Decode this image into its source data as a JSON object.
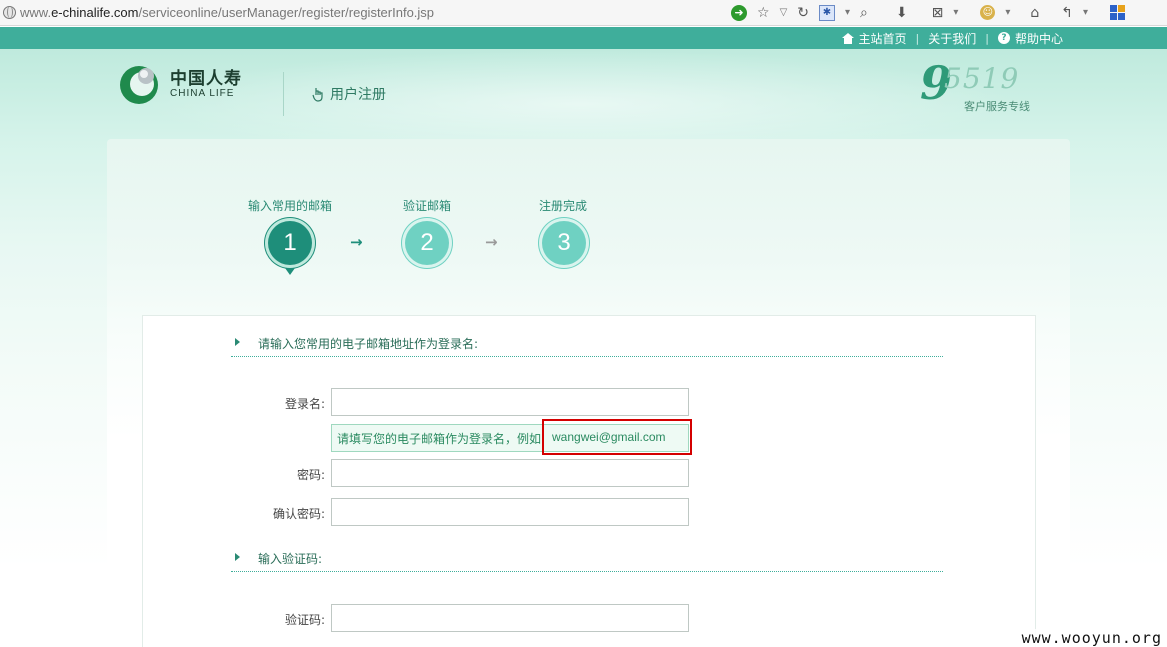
{
  "browser": {
    "url_prefix": "www.",
    "url_domain": "e-chinalife.com",
    "url_path": "/serviceonline/userManager/register/registerInfo.jsp",
    "go_icon": "green-arrow-icon",
    "toolbar_icons": [
      "go-icon",
      "star-icon",
      "dropdown-icon",
      "refresh-icon",
      "search-engine-icon",
      "download-icon",
      "screenshot-icon",
      "addon-icon",
      "home-icon",
      "back-share-icon",
      "windows-icon"
    ]
  },
  "topnav": {
    "home": "主站首页",
    "sep": "|",
    "about": "关于我们",
    "help": "帮助中心",
    "help_glyph": "?"
  },
  "logo": {
    "cn": "中国人寿",
    "en": "CHINA LIFE"
  },
  "page_tag": "用户注册",
  "hotline": {
    "number_head": "9",
    "number_tail": "5519",
    "label": "客户服务专线"
  },
  "steps": [
    {
      "label": "输入常用的邮箱",
      "num": "1",
      "state": "active"
    },
    {
      "label": "验证邮箱",
      "num": "2",
      "state": "inactive"
    },
    {
      "label": "注册完成",
      "num": "3",
      "state": "inactive"
    }
  ],
  "arrow_glyph": "→",
  "colors": {
    "accent": "#3fae9b",
    "active_step": "#1e8e7a",
    "inactive_step": "#6fd1c2",
    "highlight": "#d40000"
  },
  "form": {
    "section1_title": "请输入您常用的电子邮箱地址作为登录名:",
    "login_label": "登录名:",
    "login_value": "",
    "hint": "请填写您的电子邮箱作为登录名，例如",
    "hint_example": "wangwei@gmail.com",
    "password_label": "密码:",
    "password_value": "",
    "confirm_label": "确认密码:",
    "confirm_value": "",
    "section2_title": "输入验证码:",
    "captcha_label": "验证码:",
    "captcha_value": ""
  },
  "watermark": "www.wooyun.org"
}
